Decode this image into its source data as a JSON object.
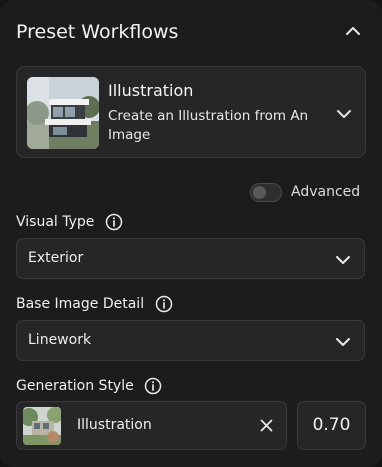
{
  "panel": {
    "title": "Preset Workflows"
  },
  "preset": {
    "title": "Illustration",
    "description": "Create an Illustration from An Image"
  },
  "advanced": {
    "label": "Advanced",
    "enabled": false
  },
  "visual_type": {
    "label": "Visual Type",
    "value": "Exterior"
  },
  "base_image_detail": {
    "label": "Base Image Detail",
    "value": "Linework"
  },
  "generation_style": {
    "label": "Generation Style",
    "style_name": "Illustration",
    "strength": "0.70"
  },
  "icons": {
    "collapse": "chevron-up-icon",
    "expand": "chevron-down-icon",
    "info": "info-icon",
    "remove": "close-icon"
  },
  "colors": {
    "panel_bg": "#1c1c1c",
    "field_bg": "#262626",
    "border": "#3a3a3a",
    "text": "#eeeeee"
  }
}
